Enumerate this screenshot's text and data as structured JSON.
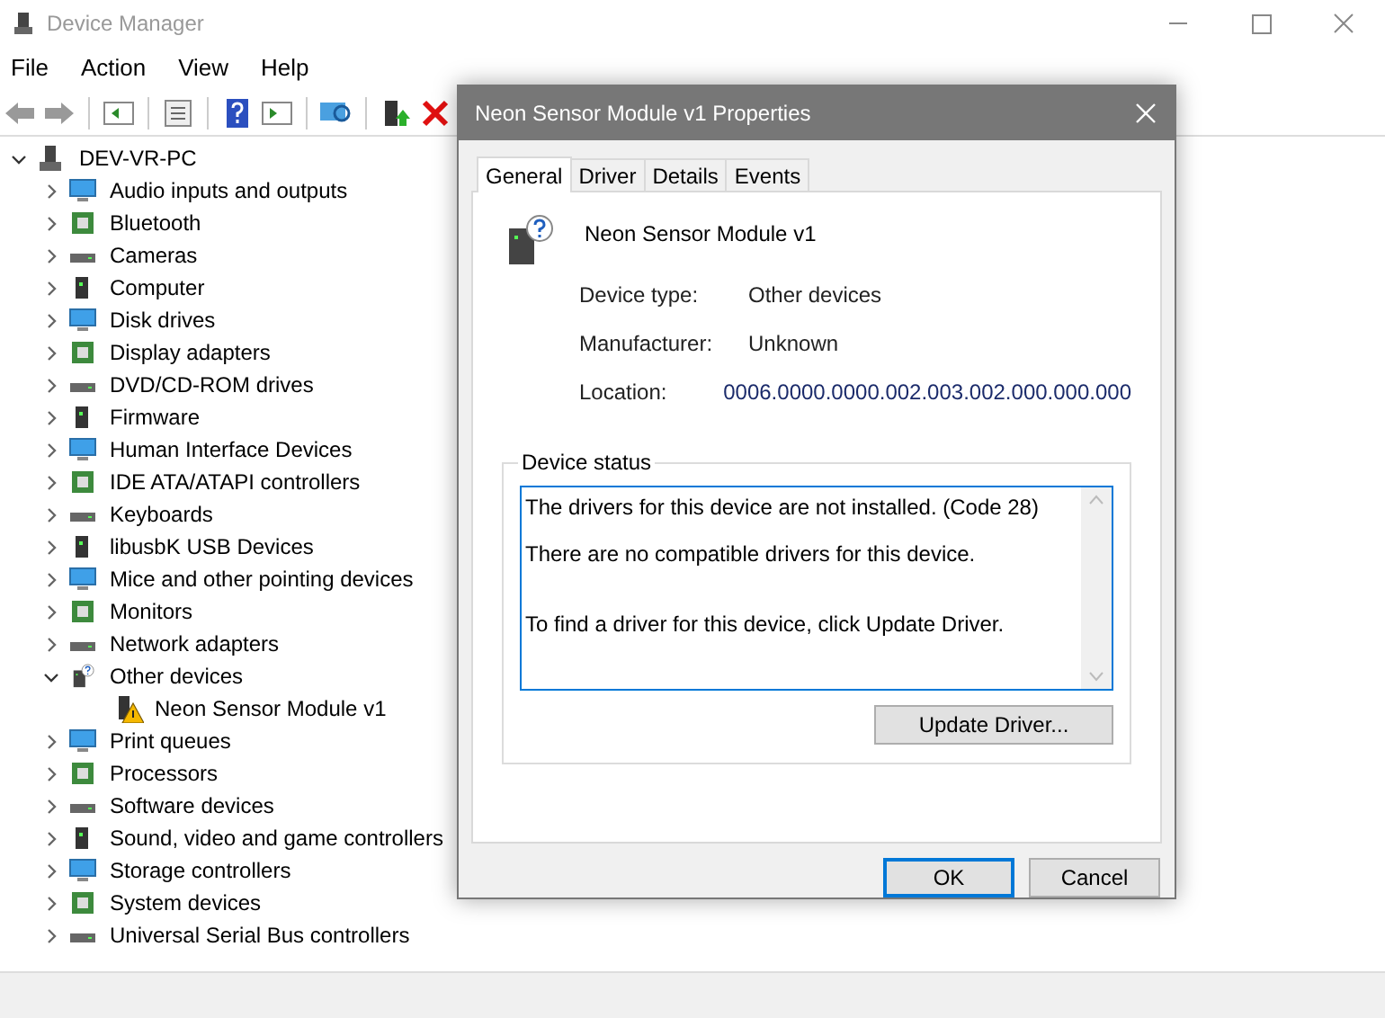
{
  "window": {
    "title": "Device Manager"
  },
  "menu": [
    "File",
    "Action",
    "View",
    "Help"
  ],
  "tree": {
    "label": "DEV-VR-PC",
    "expanded": true,
    "children": [
      {
        "label": "Audio inputs and outputs",
        "expanded": false
      },
      {
        "label": "Bluetooth",
        "expanded": false
      },
      {
        "label": "Cameras",
        "expanded": false
      },
      {
        "label": "Computer",
        "expanded": false
      },
      {
        "label": "Disk drives",
        "expanded": false
      },
      {
        "label": "Display adapters",
        "expanded": false
      },
      {
        "label": "DVD/CD-ROM drives",
        "expanded": false
      },
      {
        "label": "Firmware",
        "expanded": false
      },
      {
        "label": "Human Interface Devices",
        "expanded": false
      },
      {
        "label": "IDE ATA/ATAPI controllers",
        "expanded": false
      },
      {
        "label": "Keyboards",
        "expanded": false
      },
      {
        "label": "libusbK USB Devices",
        "expanded": false
      },
      {
        "label": "Mice and other pointing devices",
        "expanded": false
      },
      {
        "label": "Monitors",
        "expanded": false
      },
      {
        "label": "Network adapters",
        "expanded": false
      },
      {
        "label": "Other devices",
        "expanded": true,
        "children": [
          {
            "label": "Neon Sensor Module v1",
            "problem": true
          }
        ]
      },
      {
        "label": "Print queues",
        "expanded": false
      },
      {
        "label": "Processors",
        "expanded": false
      },
      {
        "label": "Software devices",
        "expanded": false
      },
      {
        "label": "Sound, video and game controllers",
        "expanded": false
      },
      {
        "label": "Storage controllers",
        "expanded": false
      },
      {
        "label": "System devices",
        "expanded": false
      },
      {
        "label": "Universal Serial Bus controllers",
        "expanded": false
      }
    ]
  },
  "dialog": {
    "title": "Neon Sensor Module v1 Properties",
    "tabs": [
      {
        "label": "General",
        "selected": true
      },
      {
        "label": "Driver",
        "selected": false
      },
      {
        "label": "Details",
        "selected": false
      },
      {
        "label": "Events",
        "selected": false
      }
    ],
    "device_name": "Neon Sensor Module v1",
    "properties": [
      {
        "label": "Device type:",
        "value": "Other devices"
      },
      {
        "label": "Manufacturer:",
        "value": "Unknown"
      },
      {
        "label": "Location:",
        "value": "0006.0000.0000.002.003.002.000.000.000"
      }
    ],
    "status_group": "Device status",
    "status_text": [
      "The drivers for this device are not installed. (Code 28)",
      "There are no compatible drivers for this device.",
      "To find a driver for this device, click Update Driver."
    ],
    "update_button": "Update Driver...",
    "buttons": [
      {
        "label": "OK",
        "default": true
      },
      {
        "label": "Cancel",
        "default": false
      }
    ]
  }
}
